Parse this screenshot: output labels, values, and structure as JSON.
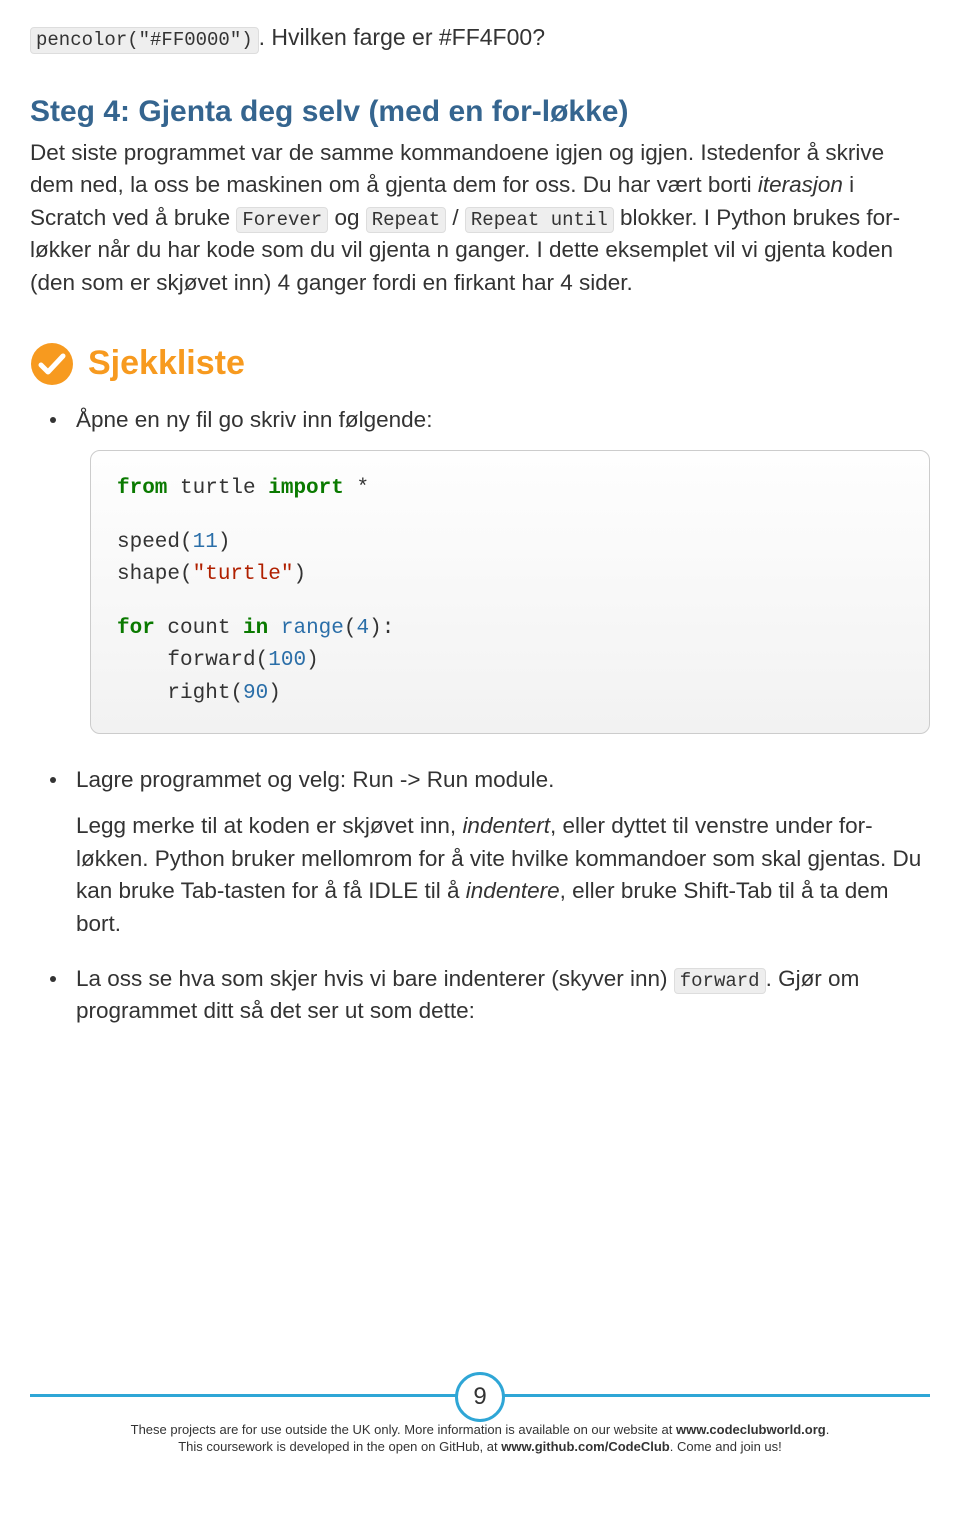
{
  "intro": {
    "code": "pencolor(\"#FF0000\")",
    "after": ". Hvilken farge er #FF4F00?"
  },
  "step4": {
    "heading": "Steg 4: Gjenta deg selv (med en for-løkke)",
    "p_part1": "Det siste programmet var de samme kommandoene igjen og igjen. Istedenfor å skrive dem ned, la oss be maskinen om å gjenta dem for oss. Du har vært borti ",
    "p_italic1": "iterasjon",
    "p_part2": " i Scratch ved å bruke ",
    "code1": "Forever",
    "p_part3": " og ",
    "code2": "Repeat",
    "p_slash": " / ",
    "code3": "Repeat until",
    "p_part4": " blokker. I Python brukes for-løkker når du har kode som du vil gjenta n ganger. I dette eksemplet vil vi gjenta koden (den som er skjøvet inn) 4 ganger fordi en firkant har 4 sider."
  },
  "checklist": {
    "title": "Sjekkliste",
    "item1": "Åpne en ny fil go skriv inn følgende:",
    "item2": "Lagre programmet og velg: Run -> Run module.",
    "item2b_part1": "Legg merke til at koden er skjøvet inn, ",
    "item2b_italic1": "indentert",
    "item2b_part2": ", eller dyttet til venstre under for-løkken. Python bruker mellomrom for å vite hvilke kommandoer som skal gjentas. Du kan bruke Tab-tasten for å få IDLE til å ",
    "item2b_italic2": "indentere",
    "item2b_part3": ", eller bruke Shift-Tab til å ta dem bort.",
    "item3_part1": "La oss se hva som skjer hvis vi bare indenterer (skyver inn) ",
    "item3_code": "forward",
    "item3_part2": ". Gjør om programmet ditt så det ser ut som dette:"
  },
  "code": {
    "line1_kw1": "from",
    "line1_mid": " turtle ",
    "line1_kw2": "import",
    "line1_end": " *",
    "line3_name": "speed",
    "line3_open": "(",
    "line3_num": "11",
    "line3_close": ")",
    "line4_name": "shape",
    "line4_open": "(",
    "line4_str": "\"turtle\"",
    "line4_close": ")",
    "line6_kw1": "for",
    "line6_var": " count ",
    "line6_kw2": "in",
    "line6_sp": " ",
    "line6_fn": "range",
    "line6_open": "(",
    "line6_num": "4",
    "line6_close": "):",
    "line7_indent": "    ",
    "line7_name": "forward",
    "line7_open": "(",
    "line7_num": "100",
    "line7_close": ")",
    "line8_indent": "    ",
    "line8_name": "right",
    "line8_open": "(",
    "line8_num": "90",
    "line8_close": ")"
  },
  "footer": {
    "page_number": "9",
    "line1a": "These projects are for use outside the UK only. More information is available on our website at ",
    "line1b": "www.codeclubworld.org",
    "line1c": ".",
    "line2a": "This coursework is developed in the open on GitHub, at ",
    "line2b": "www.github.com/CodeClub",
    "line2c": ". Come and join us!"
  }
}
